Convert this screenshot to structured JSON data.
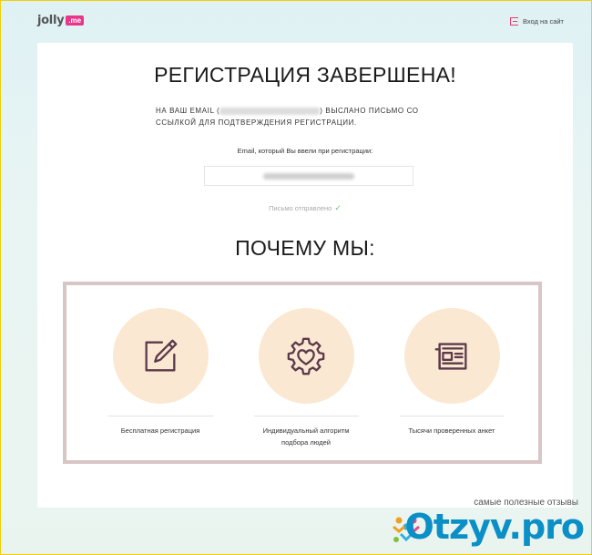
{
  "header": {
    "logo_text": "jolly",
    "logo_badge": ".me",
    "login_label": "Вход на сайт"
  },
  "main": {
    "title": "РЕГИСТРАЦИЯ ЗАВЕРШЕНА!",
    "message_prefix": "НА ВАШ EMAIL (",
    "message_suffix": ") ВЫСЛАНО ПИСЬМО СО ССЫЛКОЙ ДЛЯ ПОДТВЕРЖДЕНИЯ РЕГИСТРАЦИИ.",
    "email_label": "Email, который Вы ввели при регистрации:",
    "sent_status": "Письмо отправлено",
    "why_title": "ПОЧЕМУ МЫ:"
  },
  "features": [
    {
      "label": "Бесплатная регистрация",
      "icon": "pencil-square-icon"
    },
    {
      "label": "Индивидуальный алгоритм подбора людей",
      "icon": "heart-gear-icon"
    },
    {
      "label": "Тысячи проверенных анкет",
      "icon": "newspaper-icon"
    }
  ],
  "watermark": {
    "tagline": "самые полезные отзывы",
    "brand": "Otzyv.pro"
  },
  "colors": {
    "accent_pink": "#e8378b",
    "circle_bg": "#fbe8d3",
    "icon_stroke": "#5b3a4a",
    "check_green": "#6cc080",
    "frame_border": "#d8c6c6"
  }
}
